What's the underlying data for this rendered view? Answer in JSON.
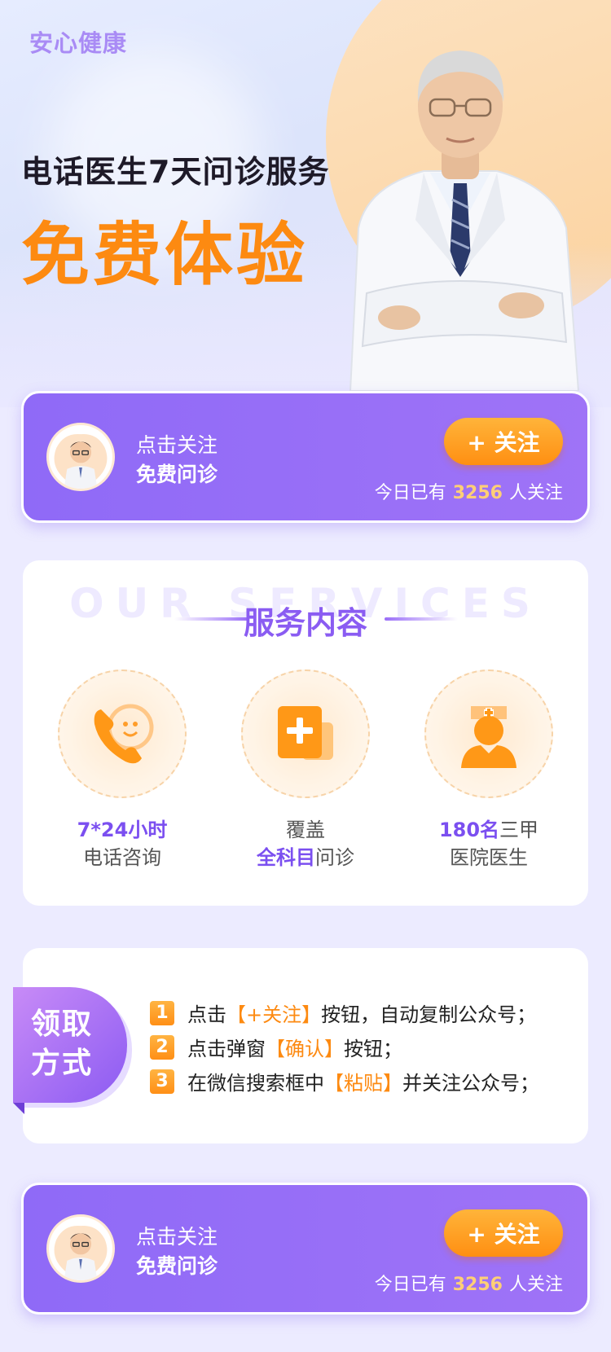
{
  "hero": {
    "brand": "安心健康",
    "subtitle": "电话医生7天问诊服务",
    "title": "免费体验"
  },
  "follow": {
    "line1": "点击关注",
    "line2": "免费问诊",
    "button_label": "+ 关注",
    "count_prefix": "今日已有",
    "count": "3256",
    "count_suffix": "人关注"
  },
  "services": {
    "watermark": "OUR SERVICES",
    "title": "服务内容",
    "items": [
      {
        "icon": "phone-icon",
        "line1_hl": "7*24小时",
        "line1_rest": "",
        "line2_hl": "",
        "line2_rest": "电话咨询"
      },
      {
        "icon": "medical-kit-icon",
        "line1_hl": "",
        "line1_rest": "覆盖",
        "line2_hl": "全科目",
        "line2_rest": "问诊"
      },
      {
        "icon": "nurse-icon",
        "line1_hl": "180名",
        "line1_rest": "三甲",
        "line2_hl": "",
        "line2_rest": "医院医生"
      }
    ]
  },
  "claim": {
    "tag_line1": "领取",
    "tag_line2": "方式",
    "steps": [
      {
        "num": "1",
        "pre": "点击",
        "highlight": "【+关注】",
        "post": "按钮，自动复制公众号；"
      },
      {
        "num": "2",
        "pre": "点击弹窗",
        "highlight": "【确认】",
        "post": "按钮；"
      },
      {
        "num": "3",
        "pre": "在微信搜索框中",
        "highlight": "【粘贴】",
        "post": "并关注公众号；"
      }
    ]
  },
  "colors": {
    "accent_purple": "#8f6af7",
    "accent_orange": "#fd8a11"
  }
}
